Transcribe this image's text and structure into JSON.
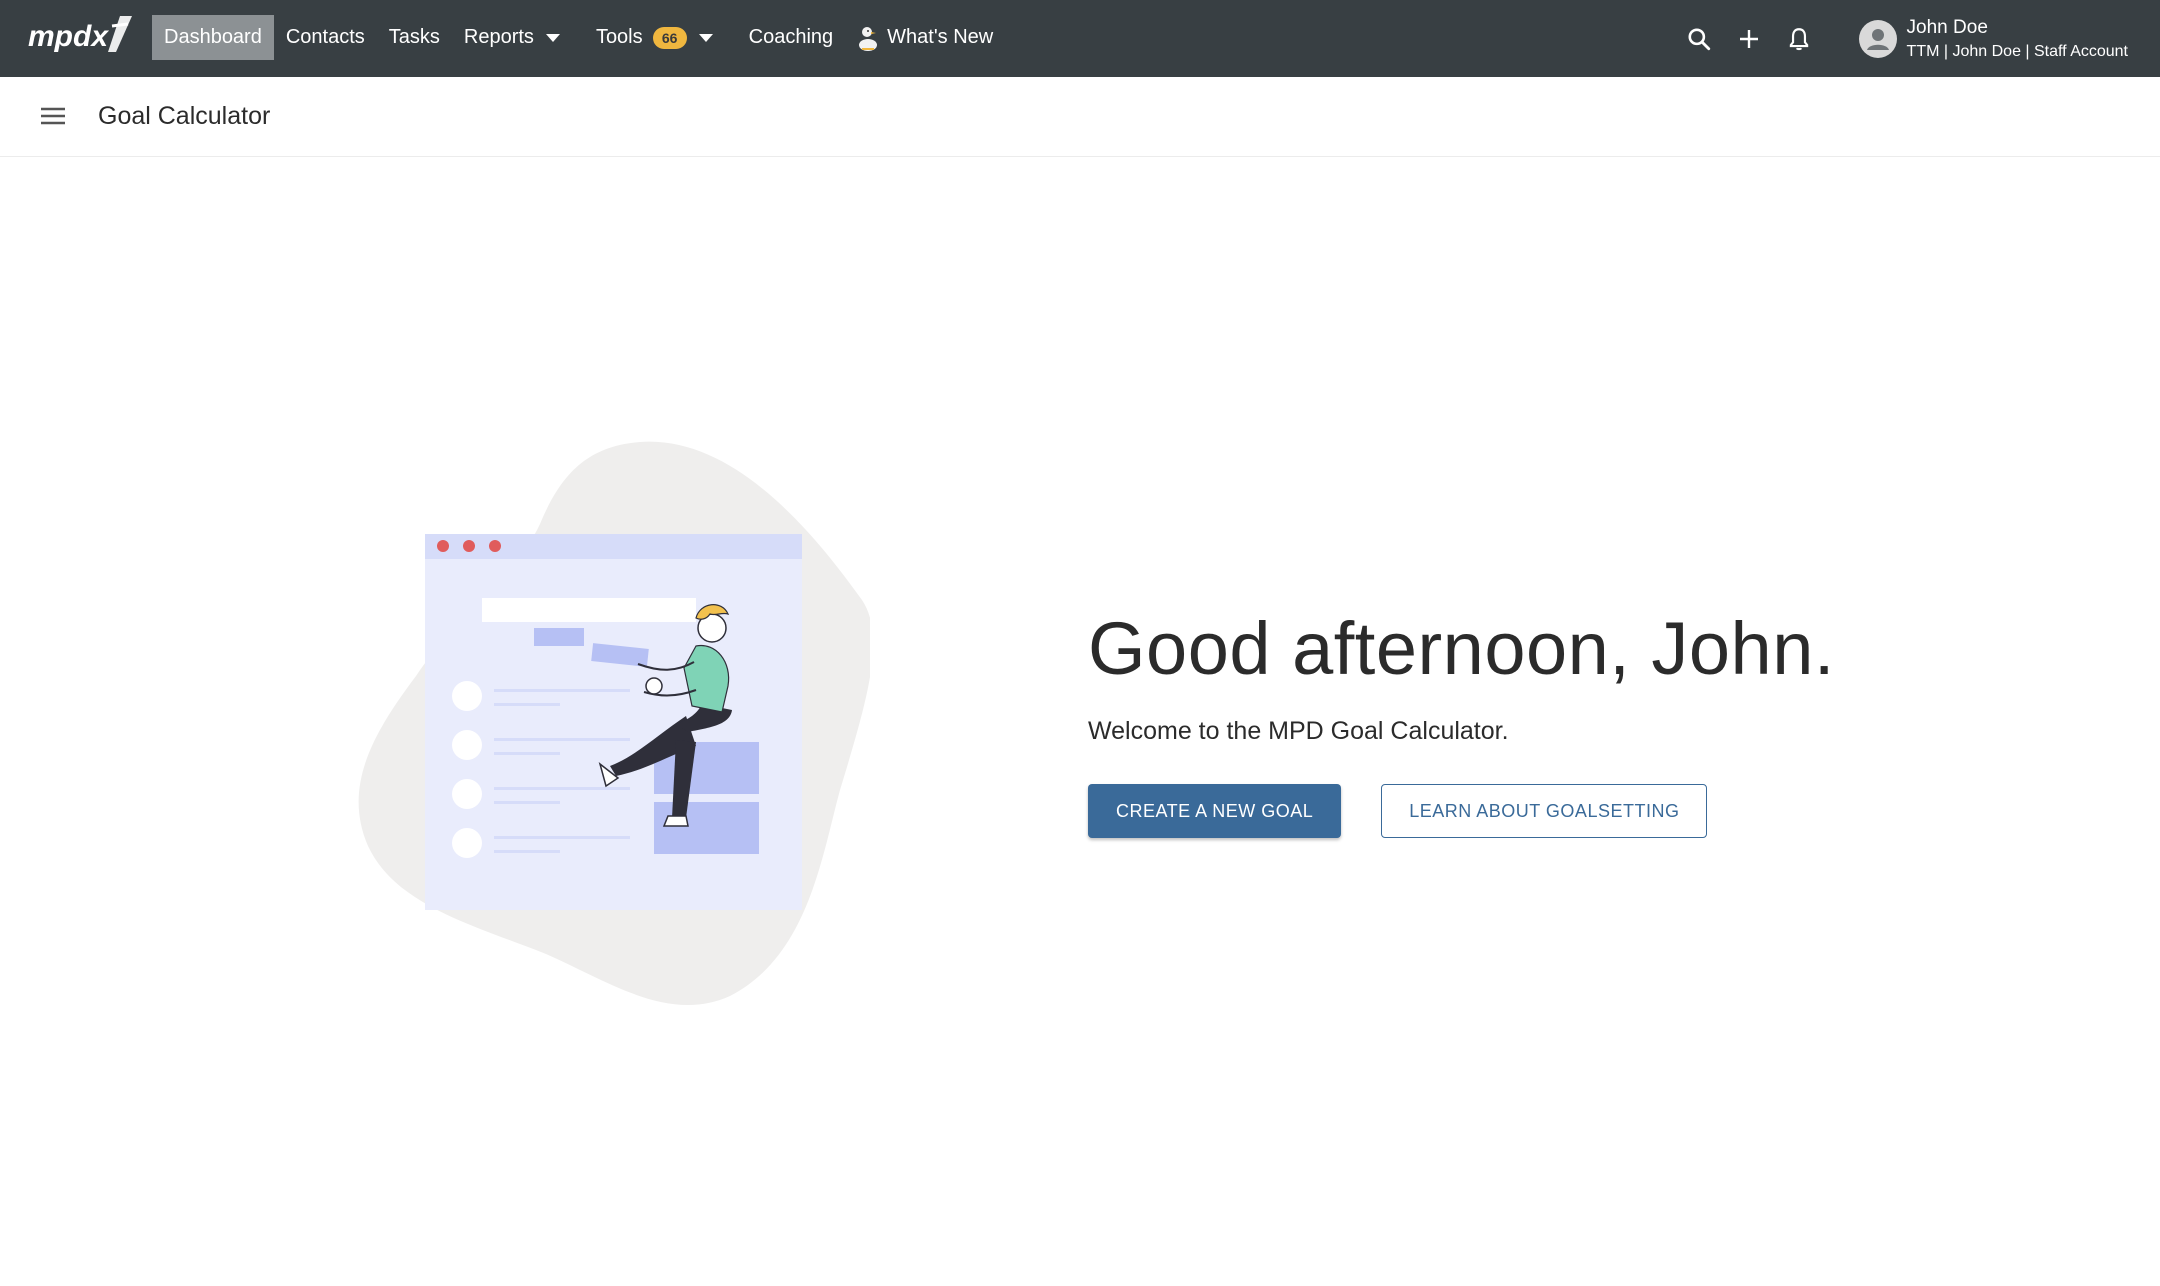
{
  "topbar": {
    "logo_text": "mpdx",
    "nav": [
      {
        "label": "Dashboard",
        "active": true
      },
      {
        "label": "Contacts"
      },
      {
        "label": "Tasks"
      },
      {
        "label": "Reports",
        "dropdown": true
      },
      {
        "label": "Tools",
        "badge": "66",
        "dropdown": true
      },
      {
        "label": "Coaching"
      },
      {
        "label": "What's New",
        "icon": "duck-icon"
      }
    ],
    "icons": [
      "search-icon",
      "add-icon",
      "bell-icon"
    ],
    "user": {
      "name": "John Doe",
      "subtitle": "TTM | John Doe | Staff Account"
    }
  },
  "subheader": {
    "title": "Goal Calculator",
    "menu_icon": "hamburger-icon"
  },
  "hero": {
    "greeting": "Good afternoon, John.",
    "welcome": "Welcome to the MPD Goal Calculator.",
    "primary_button": "CREATE A NEW GOAL",
    "secondary_button": "LEARN ABOUT GOALSETTING"
  },
  "colors": {
    "topbar_bg": "#383f43",
    "active_nav_bg": "#8c9194",
    "badge": "#f0b73f",
    "primary": "#3a6a99",
    "illustration_window": "#e9ecfc",
    "illustration_accent": "#b6c0f4",
    "window_dots": "#e05c5c",
    "person_shirt": "#7fd3b6",
    "person_hair": "#f2c14e"
  }
}
